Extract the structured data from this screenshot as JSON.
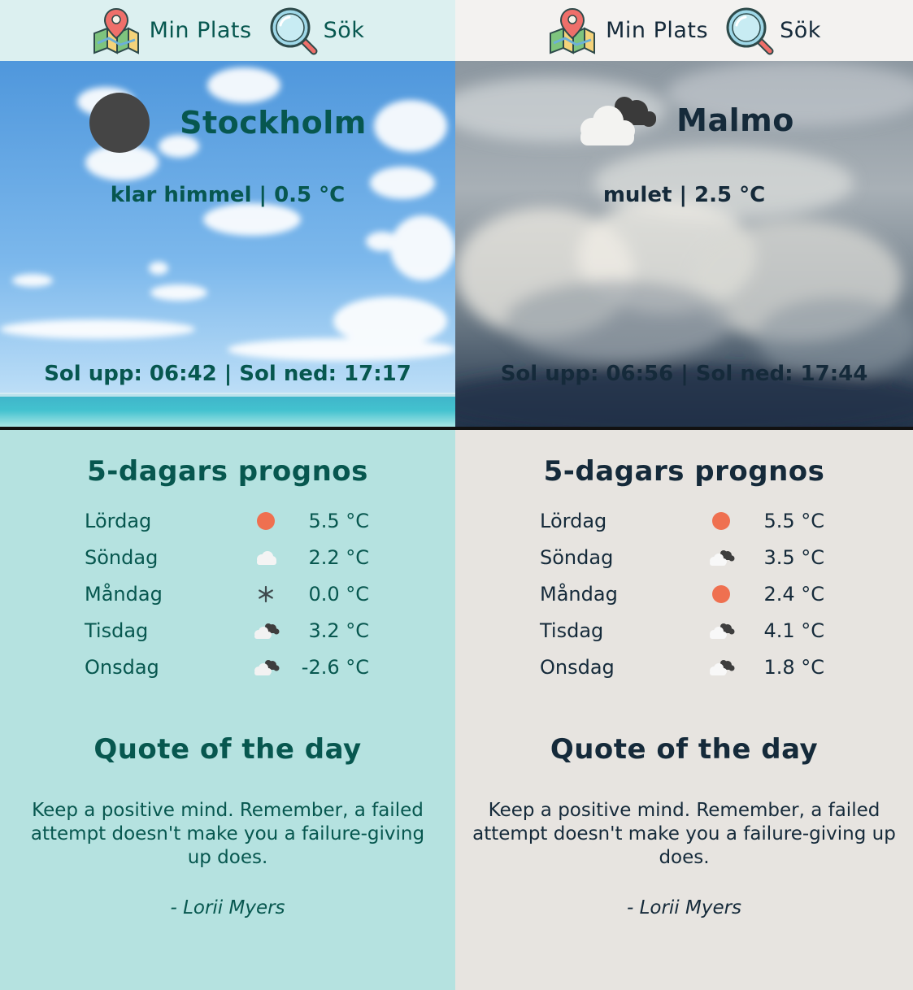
{
  "nav": {
    "location_label": "Min Plats",
    "search_label": "Sök"
  },
  "panels": [
    {
      "city": "Stockholm",
      "description": "klar himmel | 0.5 °C",
      "sun_times": "Sol upp: 06:42 |  Sol ned: 17:17",
      "current_icon": "moon-icon",
      "forecast_title": "5-dagars prognos",
      "forecast": [
        {
          "day": "Lördag",
          "icon": "sun-icon",
          "temp": "5.5 °C"
        },
        {
          "day": "Söndag",
          "icon": "cloud-icon",
          "temp": "2.2 °C"
        },
        {
          "day": "Måndag",
          "icon": "snowflake-icon",
          "temp": "0.0 °C"
        },
        {
          "day": "Tisdag",
          "icon": "broken-clouds-icon",
          "temp": "3.2 °C"
        },
        {
          "day": "Onsdag",
          "icon": "broken-clouds-icon",
          "temp": "-2.6 °C"
        }
      ],
      "quote_title": "Quote of the day",
      "quote": "Keep a positive mind. Remember, a failed attempt doesn't make you a failure-giving up does.",
      "quote_author": "- Lorii Myers",
      "colors": {
        "text": "#07574f",
        "background": "#b5e2e0",
        "nav": "#dcf0f0"
      }
    },
    {
      "city": "Malmo",
      "description": "mulet | 2.5 °C",
      "sun_times": "Sol upp: 06:56 |  Sol ned: 17:44",
      "current_icon": "broken-clouds-icon",
      "forecast_title": "5-dagars prognos",
      "forecast": [
        {
          "day": "Lördag",
          "icon": "sun-icon",
          "temp": "5.5 °C"
        },
        {
          "day": "Söndag",
          "icon": "broken-clouds-icon",
          "temp": "3.5 °C"
        },
        {
          "day": "Måndag",
          "icon": "sun-icon",
          "temp": "2.4 °C"
        },
        {
          "day": "Tisdag",
          "icon": "broken-clouds-icon",
          "temp": "4.1 °C"
        },
        {
          "day": "Onsdag",
          "icon": "broken-clouds-icon",
          "temp": "1.8 °C"
        }
      ],
      "quote_title": "Quote of the day",
      "quote": "Keep a positive mind. Remember, a failed attempt doesn't make you a failure-giving up does.",
      "quote_author": "- Lorii Myers",
      "colors": {
        "text": "#152a3a",
        "background": "#e7e4e0",
        "nav": "#f3f2f0"
      }
    }
  ]
}
